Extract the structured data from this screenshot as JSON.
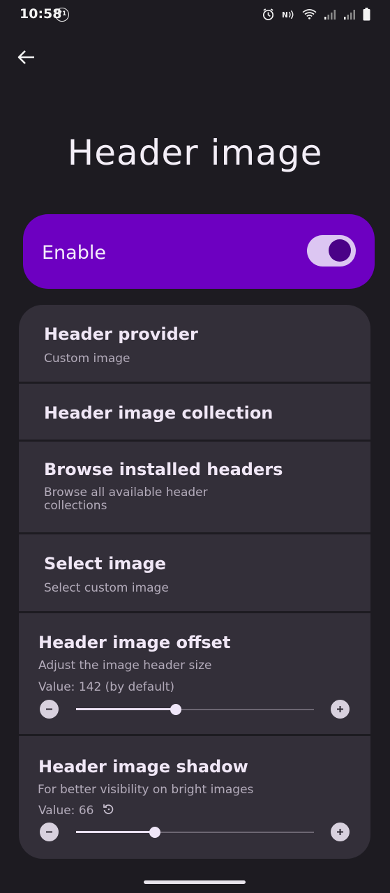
{
  "status_bar": {
    "time": "10:58",
    "badge": "71",
    "icons": [
      "alarm-icon",
      "nfc-icon",
      "wifi-icon",
      "signal-icon",
      "signal-icon",
      "battery-icon"
    ]
  },
  "header": {
    "back_icon": "back-arrow-icon",
    "title": "Header image"
  },
  "enable": {
    "label": "Enable",
    "toggled_on": true,
    "accent": "#6d00c1"
  },
  "settings": {
    "provider": {
      "title": "Header provider",
      "subtitle": "Custom image"
    },
    "collection": {
      "title": "Header image collection"
    },
    "browse": {
      "title": "Browse installed headers",
      "subtitle_line1": "Browse all available header",
      "subtitle_line2": "collections"
    },
    "select": {
      "title": "Select image",
      "subtitle": "Select custom image"
    },
    "offset": {
      "title": "Header image offset",
      "subtitle": "Adjust the image header size",
      "value_text": "Value: 142 (by default)",
      "slider_fraction": 0.42
    },
    "shadow": {
      "title": "Header image shadow",
      "subtitle": "For better visibility on bright images",
      "value_text": "Value: 66",
      "slider_fraction": 0.33
    }
  }
}
